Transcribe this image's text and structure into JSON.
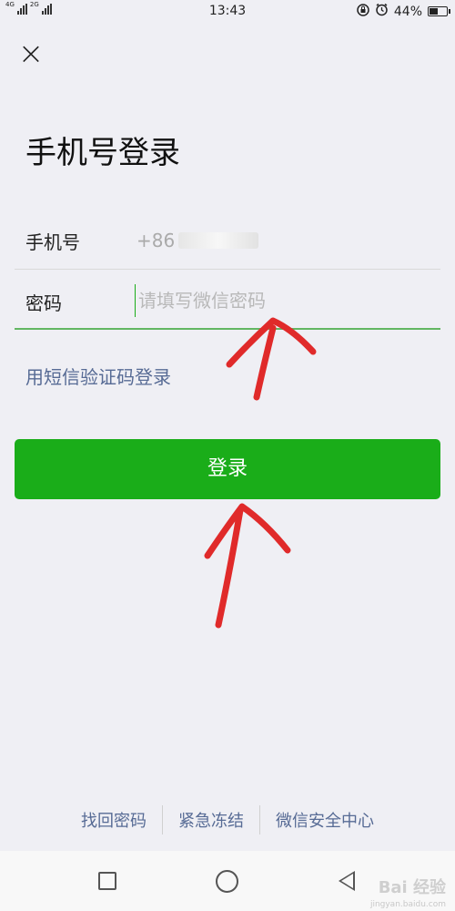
{
  "status_bar": {
    "network_left": "4G",
    "network_right": "2G",
    "time": "13:43",
    "battery_percent": "44%",
    "battery_level": 0.44,
    "icons": [
      "signal-icon",
      "lock-rotation-icon",
      "alarm-icon",
      "battery-icon"
    ]
  },
  "header": {
    "close_icon": "×",
    "title": "手机号登录"
  },
  "form": {
    "phone_label": "手机号",
    "phone_prefix": "+86",
    "password_label": "密码",
    "password_placeholder": "请填写微信密码",
    "password_value": ""
  },
  "links": {
    "sms_login": "用短信验证码登录"
  },
  "buttons": {
    "login": "登录"
  },
  "footer": {
    "links": [
      "找回密码",
      "紧急冻结",
      "微信安全中心"
    ]
  },
  "watermark": {
    "logo": "Bai 经验",
    "url": "jingyan.baidu.com"
  },
  "colors": {
    "accent_green": "#1aad19",
    "link_blue": "#576b95",
    "annotation_red": "#e02a2a",
    "background": "#efeff4"
  }
}
